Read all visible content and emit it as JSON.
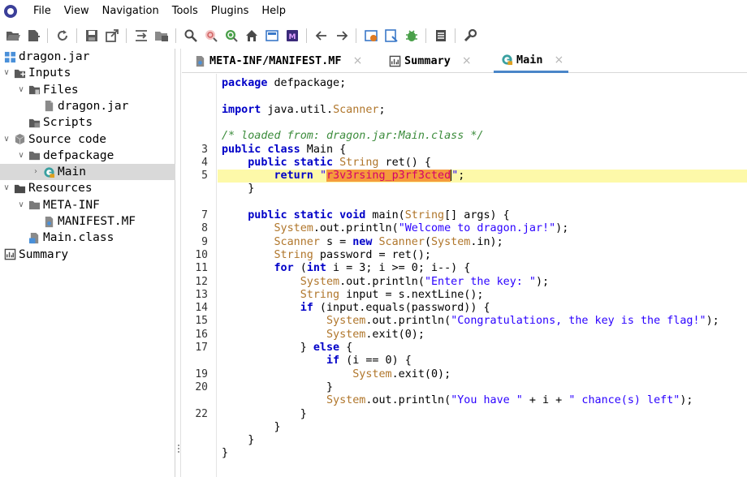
{
  "menu": {
    "items": [
      "File",
      "View",
      "Navigation",
      "Tools",
      "Plugins",
      "Help"
    ]
  },
  "toolbar": {
    "icons": [
      "open-file-icon",
      "add-files-icon",
      "reload-icon",
      "save-all-icon",
      "export-gradle-icon",
      "sync-tree-icon",
      "flatten-packages-icon",
      "search-icon",
      "find-class-icon",
      "find-usages-icon",
      "home-icon",
      "deobfuscation-icon",
      "smali-icon",
      "back-icon",
      "forward-icon",
      "quark-icon",
      "decompile-all-icon",
      "debugger-icon",
      "log-viewer-icon",
      "preferences-icon"
    ]
  },
  "tree": {
    "nodes": [
      {
        "label": "dragon.jar",
        "icon": "jar-icon",
        "indent": 0,
        "toggle": ""
      },
      {
        "label": "Inputs",
        "icon": "inputs-folder-icon",
        "indent": 0,
        "toggle": "open"
      },
      {
        "label": "Files",
        "icon": "files-folder-icon",
        "indent": 1,
        "toggle": "open"
      },
      {
        "label": "dragon.jar",
        "icon": "jar-file-icon",
        "indent": 2,
        "toggle": ""
      },
      {
        "label": "Scripts",
        "icon": "scripts-folder-icon",
        "indent": 1,
        "toggle": ""
      },
      {
        "label": "Source code",
        "icon": "source-code-icon",
        "indent": 0,
        "toggle": "open"
      },
      {
        "label": "defpackage",
        "icon": "package-icon",
        "indent": 1,
        "toggle": "open"
      },
      {
        "label": "Main",
        "icon": "class-icon",
        "indent": 2,
        "toggle": "closed",
        "selected": true
      },
      {
        "label": "Resources",
        "icon": "resources-folder-icon",
        "indent": 0,
        "toggle": "open"
      },
      {
        "label": "META-INF",
        "icon": "folder-icon",
        "indent": 1,
        "toggle": "open"
      },
      {
        "label": "MANIFEST.MF",
        "icon": "manifest-file-icon",
        "indent": 2,
        "toggle": ""
      },
      {
        "label": "Main.class",
        "icon": "class-file-icon",
        "indent": 1,
        "toggle": ""
      },
      {
        "label": "Summary",
        "icon": "summary-icon",
        "indent": 0,
        "toggle": ""
      }
    ]
  },
  "tabs": [
    {
      "label": "META-INF/MANIFEST.MF",
      "icon": "manifest-file-icon",
      "active": false
    },
    {
      "label": "Summary",
      "icon": "summary-icon",
      "active": false
    },
    {
      "label": "Main",
      "icon": "class-icon",
      "active": true
    }
  ],
  "tab_close_glyph": "×",
  "editor": {
    "line_numbers": [
      "",
      "",
      "",
      "",
      "",
      "3",
      "4",
      "5",
      "",
      "",
      "7",
      "8",
      "9",
      "10",
      "11",
      "12",
      "13",
      "14",
      "15",
      "16",
      "17",
      "",
      "19",
      "20",
      "",
      "22",
      "",
      "",
      "",
      ""
    ],
    "highlighted_line": 7,
    "lines": [
      [
        [
          "kw",
          "package"
        ],
        [
          "",
          " defpackage;"
        ]
      ],
      [],
      [
        [
          "kw",
          "import"
        ],
        [
          "",
          " java.util."
        ],
        [
          "ty",
          "Scanner"
        ],
        [
          "",
          ";"
        ]
      ],
      [],
      [
        [
          "ct",
          "/* loaded from: dragon.jar:Main.class */"
        ]
      ],
      [
        [
          "kw",
          "public class"
        ],
        [
          "",
          " Main {"
        ]
      ],
      [
        [
          "",
          "    "
        ],
        [
          "kw",
          "public static"
        ],
        [
          "",
          " "
        ],
        [
          "ty",
          "String"
        ],
        [
          "",
          " ret() {"
        ]
      ],
      [
        [
          "",
          "        "
        ],
        [
          "kw",
          "return"
        ],
        [
          "",
          " "
        ],
        [
          "st",
          "\""
        ],
        [
          "hl",
          "r3v3rsing_p3rf3cted"
        ],
        [
          "caret",
          ""
        ],
        [
          "st",
          "\""
        ],
        [
          "",
          ";"
        ]
      ],
      [
        [
          "",
          "    }"
        ]
      ],
      [],
      [
        [
          "",
          "    "
        ],
        [
          "kw",
          "public static void"
        ],
        [
          "",
          " main("
        ],
        [
          "ty",
          "String"
        ],
        [
          "",
          "[] args) {"
        ]
      ],
      [
        [
          "",
          "        "
        ],
        [
          "ty",
          "System"
        ],
        [
          "",
          ".out.println("
        ],
        [
          "st",
          "\"Welcome to dragon.jar!\""
        ],
        [
          "",
          ");"
        ]
      ],
      [
        [
          "",
          "        "
        ],
        [
          "ty",
          "Scanner"
        ],
        [
          "",
          " s = "
        ],
        [
          "kw",
          "new"
        ],
        [
          "",
          " "
        ],
        [
          "ty",
          "Scanner"
        ],
        [
          "",
          "("
        ],
        [
          "ty",
          "System"
        ],
        [
          "",
          ".in);"
        ]
      ],
      [
        [
          "",
          "        "
        ],
        [
          "ty",
          "String"
        ],
        [
          "",
          " password = ret();"
        ]
      ],
      [
        [
          "",
          "        "
        ],
        [
          "kw",
          "for"
        ],
        [
          "",
          " ("
        ],
        [
          "kw",
          "int"
        ],
        [
          "",
          " i = 3; i >= 0; i--) {"
        ]
      ],
      [
        [
          "",
          "            "
        ],
        [
          "ty",
          "System"
        ],
        [
          "",
          ".out.println("
        ],
        [
          "st",
          "\"Enter the key: \""
        ],
        [
          "",
          ");"
        ]
      ],
      [
        [
          "",
          "            "
        ],
        [
          "ty",
          "String"
        ],
        [
          "",
          " input = s.nextLine();"
        ]
      ],
      [
        [
          "",
          "            "
        ],
        [
          "kw",
          "if"
        ],
        [
          "",
          " (input.equals(password)) {"
        ]
      ],
      [
        [
          "",
          "                "
        ],
        [
          "ty",
          "System"
        ],
        [
          "",
          ".out.println("
        ],
        [
          "st",
          "\"Congratulations, the key is the flag!\""
        ],
        [
          "",
          ");"
        ]
      ],
      [
        [
          "",
          "                "
        ],
        [
          "ty",
          "System"
        ],
        [
          "",
          ".exit(0);"
        ]
      ],
      [
        [
          "",
          "            } "
        ],
        [
          "kw",
          "else"
        ],
        [
          "",
          " {"
        ]
      ],
      [
        [
          "",
          "                "
        ],
        [
          "kw",
          "if"
        ],
        [
          "",
          " (i == 0) {"
        ]
      ],
      [
        [
          "",
          "                    "
        ],
        [
          "ty",
          "System"
        ],
        [
          "",
          ".exit(0);"
        ]
      ],
      [
        [
          "",
          "                }"
        ]
      ],
      [
        [
          "",
          "                "
        ],
        [
          "ty",
          "System"
        ],
        [
          "",
          ".out.println("
        ],
        [
          "st",
          "\"You have \""
        ],
        [
          "",
          " + i + "
        ],
        [
          "st",
          "\" chance(s) left\""
        ],
        [
          "",
          ");"
        ]
      ],
      [
        [
          "",
          "            }"
        ]
      ],
      [
        [
          "",
          "        }"
        ]
      ],
      [
        [
          "",
          "    }"
        ]
      ],
      [
        [
          "",
          "}"
        ]
      ]
    ]
  }
}
